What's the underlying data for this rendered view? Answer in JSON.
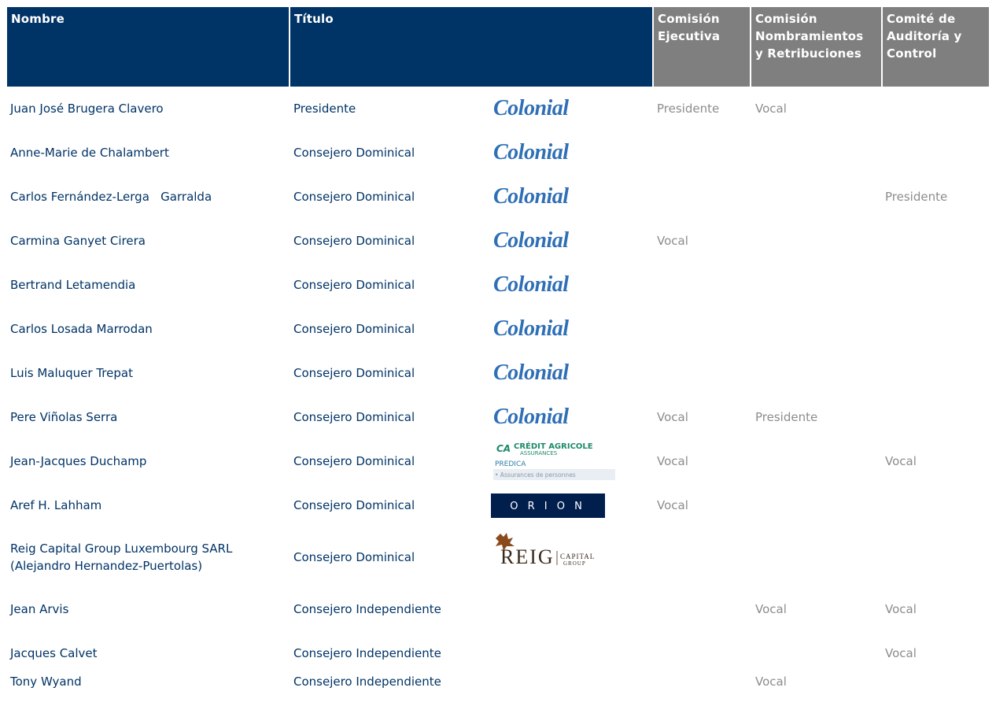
{
  "header": {
    "nombre": "Nombre",
    "titulo": "Título",
    "comision_ejecutiva": [
      "Comisión",
      "Ejecutiva"
    ],
    "comision_nombramientos": [
      "Comisión",
      "Nombramientos",
      "y Retribuciones"
    ],
    "comite_auditoria": [
      "Comité de",
      "Auditoría y",
      "Control"
    ]
  },
  "logos": {
    "colonial": "Colonial",
    "credit_agricole": [
      "CRÉDIT AGRICOLE",
      "ASSURANCES",
      "PREDICA",
      "• Assurances de personnes"
    ],
    "orion": "O R I O N",
    "reig": [
      "REIG",
      "CAPITAL",
      "GROUP"
    ]
  },
  "rows": [
    {
      "nombre": "Juan José Brugera Clavero",
      "titulo": "Presidente",
      "logo": "colonial",
      "c1": "Presidente",
      "c2": "Vocal",
      "c3": ""
    },
    {
      "nombre": "Anne-Marie de Chalambert",
      "titulo": "Consejero Dominical",
      "logo": "colonial",
      "c1": "",
      "c2": "",
      "c3": ""
    },
    {
      "nombre": "Carlos Fernández-Lerga   Garralda",
      "titulo": "Consejero Dominical",
      "logo": "colonial",
      "c1": "",
      "c2": "",
      "c3": "Presidente"
    },
    {
      "nombre": "Carmina Ganyet Cirera",
      "titulo": "Consejero Dominical",
      "logo": "colonial",
      "c1": "Vocal",
      "c2": "",
      "c3": ""
    },
    {
      "nombre": "Bertrand Letamendia",
      "titulo": "Consejero Dominical",
      "logo": "colonial",
      "c1": "",
      "c2": "",
      "c3": ""
    },
    {
      "nombre": "Carlos Losada Marrodan",
      "titulo": "Consejero Dominical",
      "logo": "colonial",
      "c1": "",
      "c2": "",
      "c3": ""
    },
    {
      "nombre": "Luis Maluquer Trepat",
      "titulo": "Consejero Dominical",
      "logo": "colonial",
      "c1": "",
      "c2": "",
      "c3": ""
    },
    {
      "nombre": "Pere Viñolas Serra",
      "titulo": "Consejero Dominical",
      "logo": "colonial",
      "c1": "Vocal",
      "c2": "Presidente",
      "c3": ""
    },
    {
      "nombre": "Jean-Jacques Duchamp",
      "titulo": "Consejero Dominical",
      "logo": "credit_agricole",
      "c1": "Vocal",
      "c2": "",
      "c3": "Vocal"
    },
    {
      "nombre": "Aref H. Lahham",
      "titulo": "Consejero Dominical",
      "logo": "orion",
      "c1": "Vocal",
      "c2": "",
      "c3": ""
    },
    {
      "nombre": [
        "Reig Capital Group Luxembourg SARL",
        "(Alejandro Hernandez-Puertolas)"
      ],
      "titulo": "Consejero Dominical",
      "logo": "reig",
      "c1": "",
      "c2": "",
      "c3": ""
    },
    {
      "nombre": "Jean Arvis",
      "titulo": "Consejero Independiente",
      "logo": "",
      "c1": "",
      "c2": "Vocal",
      "c3": "Vocal"
    },
    {
      "nombre": "Jacques Calvet",
      "titulo": "Consejero Independiente",
      "logo": "",
      "c1": "",
      "c2": "",
      "c3": "Vocal"
    },
    {
      "nombre": "Tony Wyand",
      "titulo": "Consejero Independiente",
      "logo": "",
      "c1": "",
      "c2": "Vocal",
      "c3": ""
    }
  ],
  "colors": {
    "header_blue": "#003366",
    "header_gray": "#7f7f7f",
    "name_text": "#003366",
    "role_text": "#8c8c8c",
    "colonial_blue": "#2f6fb5"
  }
}
